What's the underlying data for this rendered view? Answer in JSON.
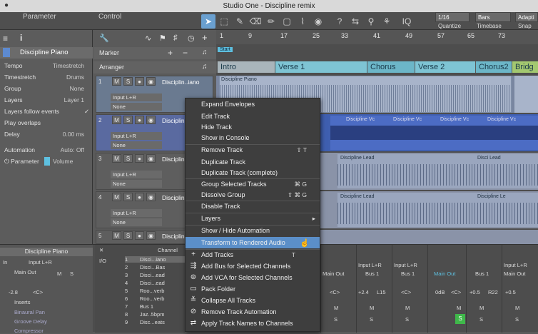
{
  "window": {
    "title": "Studio One - Discipline remix"
  },
  "header_tabs": {
    "parameter": "Parameter",
    "control": "Control"
  },
  "quantize": {
    "value": "1/16",
    "label": "Quantize",
    "timebase_value": "Bars",
    "timebase_label": "Timebase",
    "snap_value": "Adapti",
    "snap_label": "Snap",
    "iq": "IQ"
  },
  "inspector": {
    "track_name": "Discipline Piano",
    "rows": [
      {
        "label": "Tempo",
        "value": "Timestretch"
      },
      {
        "label": "Timestretch",
        "value": "Drums"
      },
      {
        "label": "Group",
        "value": "None"
      },
      {
        "label": "Layers",
        "value": "Layer 1"
      },
      {
        "label": "Layers follow events",
        "value": ""
      },
      {
        "label": "Play overlaps",
        "value": ""
      },
      {
        "label": "Delay",
        "value": "0.00 ms"
      },
      {
        "label": "Automation",
        "value": "Auto: Off"
      },
      {
        "label": "Parameter",
        "value": "Volume"
      }
    ]
  },
  "tracklist": {
    "marker": "Marker",
    "arranger": "Arranger",
    "start": "Start"
  },
  "tracks": [
    {
      "num": "1",
      "name": "Disciplin..iano",
      "input": "Input L+R",
      "sub": "None"
    },
    {
      "num": "2",
      "name": "Disciplin...",
      "input": "Input L+R",
      "sub": "None"
    },
    {
      "num": "3",
      "name": "Disciplin...",
      "input": "Input L+R",
      "sub": "None"
    },
    {
      "num": "4",
      "name": "Disciplin...",
      "input": "Input L+R",
      "sub": "None"
    },
    {
      "num": "5",
      "name": "Disciplin...",
      "input": "",
      "sub": ""
    }
  ],
  "track_buttons": {
    "m": "M",
    "s": "S"
  },
  "ruler": {
    "marks": [
      "9",
      "17",
      "25",
      "33",
      "41",
      "49",
      "57",
      "65",
      "73"
    ]
  },
  "arranger_sections": [
    "Intro",
    "Verse 1",
    "Chorus",
    "Verse 2",
    "Chorus2",
    "Bridg"
  ],
  "clips": {
    "piano": "Discipline Piano",
    "vox": "Discipline Vc",
    "lead": "Discipline Lead",
    "lead_short": "Disci Lead",
    "lead_short2": "Discipline Le"
  },
  "context_menu": {
    "items": [
      {
        "label": "Expand Envelopes",
        "shortcut": ""
      },
      {
        "label": "Edit Track",
        "shortcut": ""
      },
      {
        "label": "Hide Track",
        "shortcut": ""
      },
      {
        "label": "Show in Console",
        "shortcut": ""
      },
      {
        "label": "Remove Track",
        "shortcut": "⇧ T"
      },
      {
        "label": "Duplicate Track",
        "shortcut": ""
      },
      {
        "label": "Duplicate Track (complete)",
        "shortcut": ""
      },
      {
        "label": "Group Selected Tracks",
        "shortcut": "⌘ G"
      },
      {
        "label": "Dissolve Group",
        "shortcut": "⇧ ⌘ G"
      },
      {
        "label": "Disable Track",
        "shortcut": ""
      },
      {
        "label": "Layers",
        "shortcut": "▸"
      },
      {
        "label": "Show / Hide Automation",
        "shortcut": ""
      },
      {
        "label": "Transform to Rendered Audio",
        "shortcut": ""
      },
      {
        "label": "Add Tracks",
        "shortcut": "T"
      },
      {
        "label": "Add Bus for Selected Channels",
        "shortcut": ""
      },
      {
        "label": "Add VCA for Selected Channels",
        "shortcut": ""
      },
      {
        "label": "Pack Folder",
        "shortcut": ""
      },
      {
        "label": "Collapse All Tracks",
        "shortcut": ""
      },
      {
        "label": "Remove Track Automation",
        "shortcut": ""
      },
      {
        "label": "Apply Track Names to Channels",
        "shortcut": ""
      }
    ]
  },
  "mixer": {
    "left_title": "Discipline Piano",
    "in_label": "In",
    "in_value": "Input L+R",
    "main_out": "Main Out",
    "vol": "-2.8",
    "pan": "<C>",
    "inserts": "Inserts",
    "plugins": [
      "Binaural Pan",
      "Groove Delay",
      "Compressor"
    ],
    "channel_header": "Channel",
    "io": "I/O",
    "channel_list": [
      {
        "n": "1",
        "name": "Disci...iano"
      },
      {
        "n": "2",
        "name": "Disci...Bas"
      },
      {
        "n": "3",
        "name": "Disci...ead"
      },
      {
        "n": "4",
        "name": "Disci...ead"
      },
      {
        "n": "5",
        "name": "Roo...verb"
      },
      {
        "n": "6",
        "name": "Roo...verb"
      },
      {
        "n": "7",
        "name": "Bus 1"
      },
      {
        "n": "8",
        "name": "Jaz..5bpm"
      },
      {
        "n": "9",
        "name": "Disc...eats"
      }
    ],
    "strips": [
      {
        "in": "",
        "out": "Main Out",
        "vol": "<C>",
        "pan": ""
      },
      {
        "in": "Input L+R",
        "out": "Bus 1",
        "vol": "+2.4",
        "pan": "L15"
      },
      {
        "in": "Input L+R",
        "out": "Bus 1",
        "vol": "<C>",
        "pan": ""
      },
      {
        "in": "",
        "out": "Main Out",
        "vol": "0dB",
        "pan": "<C>"
      },
      {
        "in": "",
        "out": "Bus 1",
        "vol": "+0.5",
        "pan": "R22"
      },
      {
        "in": "Input L+R",
        "out": "Main Out",
        "vol": "+0.5",
        "pan": ""
      }
    ],
    "m": "M",
    "s": "S"
  }
}
